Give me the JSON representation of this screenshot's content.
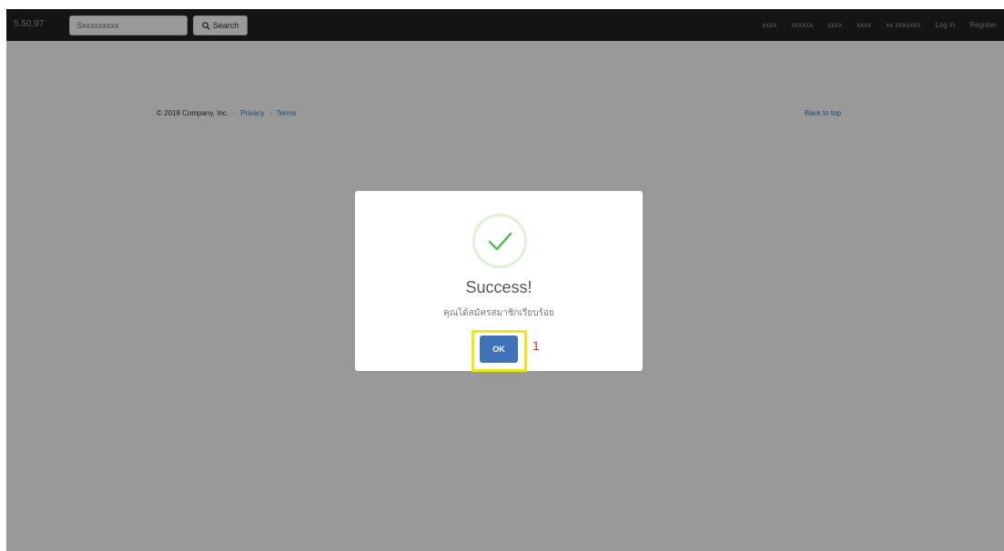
{
  "navbar": {
    "brand": "5.50.97",
    "search_placeholder": "Sxxxxxxxxx",
    "search_label": "Search",
    "links": [
      "xxxx",
      "xxxxxx",
      "xxxx",
      "xxxx",
      "xx xxxxxxx",
      "Log in",
      "Register"
    ]
  },
  "footer": {
    "copyright": "© 2018 Company, Inc.",
    "privacy": "Privacy",
    "terms": "Terms",
    "back_to_top": "Back to top"
  },
  "modal": {
    "title": "Success!",
    "text": "คุณได้สมัครสมาชิกเรียบร้อย",
    "ok_label": "OK",
    "step_marker": "1",
    "colors": {
      "ok_button": "#3f72b8",
      "checkmark": "#5cb85c",
      "highlight": "#f2e60f",
      "step_marker": "#c0392b"
    }
  }
}
